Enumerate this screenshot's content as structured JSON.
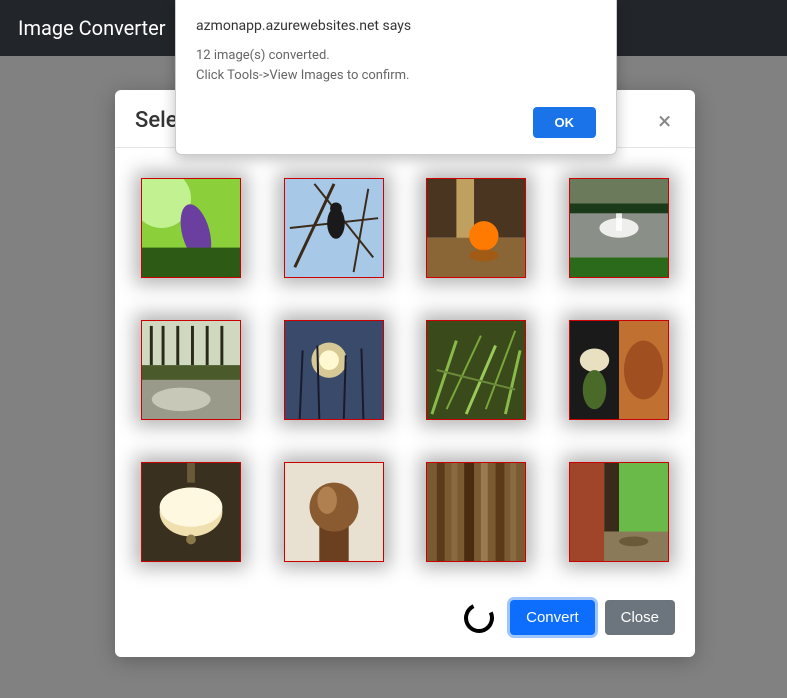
{
  "topbar": {
    "title": "Image Converter"
  },
  "modal": {
    "title": "Sele",
    "close_glyph": "×",
    "convert_label": "Convert",
    "close_label": "Close"
  },
  "alert": {
    "origin": "azmonapp.azurewebsites.net says",
    "line1": "12 image(s) converted.",
    "line2": "Click Tools->View Images to confirm.",
    "ok_label": "OK"
  },
  "thumbs": [
    {
      "name": "flower-purple"
    },
    {
      "name": "bird-branches"
    },
    {
      "name": "orange-table"
    },
    {
      "name": "fountain-park"
    },
    {
      "name": "forest-stream"
    },
    {
      "name": "sunset-reeds"
    },
    {
      "name": "grass-closeup"
    },
    {
      "name": "food-dish"
    },
    {
      "name": "lamp-ceiling"
    },
    {
      "name": "banister-knob"
    },
    {
      "name": "wood-books"
    },
    {
      "name": "lizard-wall"
    }
  ]
}
